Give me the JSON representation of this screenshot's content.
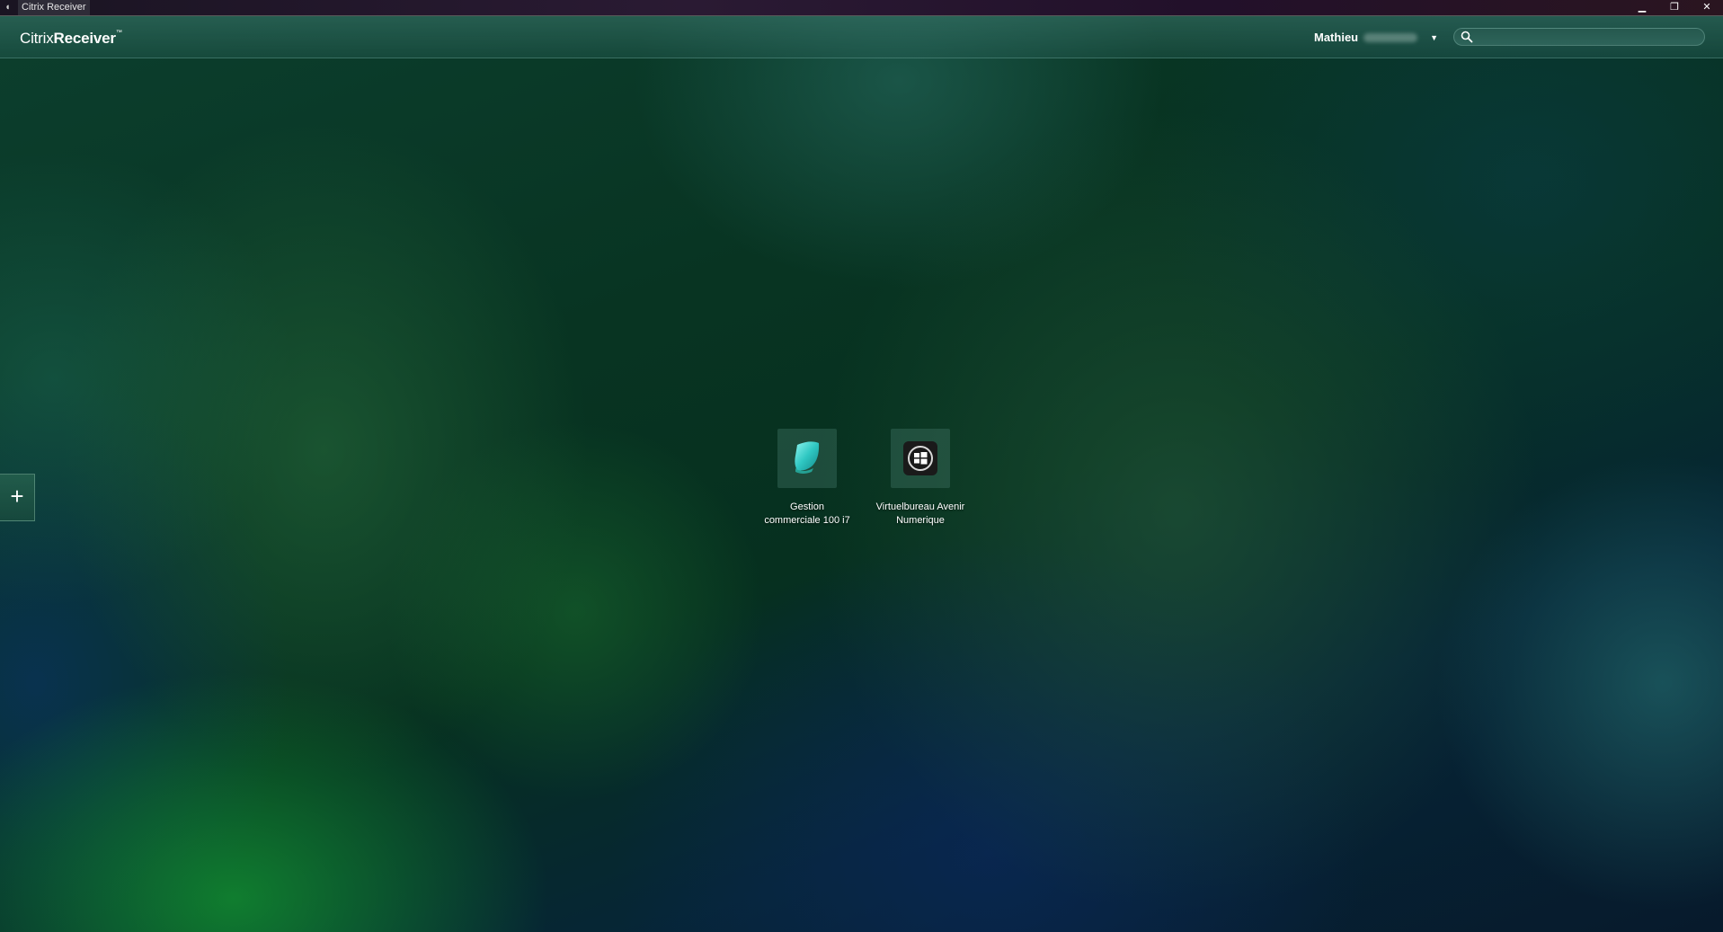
{
  "window": {
    "title": "Citrix Receiver",
    "controls": {
      "minimize": "▁",
      "restore": "❐",
      "close": "✕"
    }
  },
  "header": {
    "brand_light": "Citrix",
    "brand_bold": "Receiver",
    "brand_tm": "™",
    "user_name": "Mathieu",
    "search": {
      "value": "",
      "placeholder": ""
    }
  },
  "sidebar": {
    "add_label": "+"
  },
  "apps": [
    {
      "name_line1": "Gestion",
      "name_line2": "commerciale 100 i7",
      "icon": "teal-shield-icon"
    },
    {
      "name_line1": "Virtuelbureau Avenir",
      "name_line2": "Numerique",
      "icon": "windows-desktop-icon"
    }
  ],
  "colors": {
    "accent": "#3fd3c6",
    "header_bg": "#2f6b62",
    "text": "#ffffff"
  }
}
